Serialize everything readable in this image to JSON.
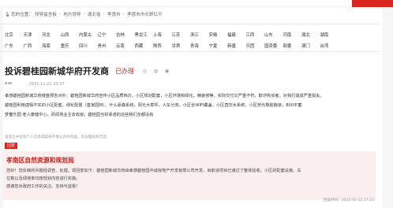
{
  "breadcrumb": {
    "prefix": "您的位置：",
    "items": [
      "领导留言板",
      "地方领导",
      "湖北省",
      "孝感市",
      "孝感市市长舒红平"
    ]
  },
  "regions": {
    "row1": [
      "北京",
      "天津",
      "河北",
      "山西",
      "内蒙古",
      "辽宁",
      "吉林",
      "黑龙江",
      "上海",
      "江苏",
      "浙江",
      "安徽",
      "福建",
      "江西",
      "山东",
      "河南",
      "湖北",
      "湖南"
    ],
    "row2": [
      "广东",
      "广西",
      "海南",
      "重庆",
      "四川",
      "贵州",
      "云南",
      "西藏",
      "陕西",
      "甘肃",
      "青海",
      "宁夏",
      "新疆",
      "兵团",
      "国资委",
      "部委",
      "澳门",
      "台湾"
    ]
  },
  "post": {
    "title": "投诉碧桂园新城华府开发商",
    "status": "已办理",
    "share_icons": [
      "weibo-icon",
      "wechat-icon",
      "qq-icon"
    ],
    "author": "",
    "date": "2021-11-22 20:37",
    "lines": [
      "孝感碧桂园新城华府楼盘预告对外：碧桂园新城华府宣传小区品质档次，小区规划配套，小区环境和绿化，精装修等，实际交付又严重不符，欺诈购买者，对我们造成严重损失。",
      "碧桂园利用虚假不实的小区配套，绿化配置（皇家园林）、什么豪森系统，阳光大草坪，人车分流，小区全WIFI覆盖，小区直饮水系统，小区荧光橡胶跑道，800平童",
      "梦童乐园 老人康健中心，而现场业主去收房，碧桂园当初承诺的这些我们全都没有"
    ],
    "disclaimer": "该留言中含有个人信息或其他不便公开的内容，仅办理机构可见。"
  },
  "reply": {
    "badge": "回复",
    "org": "孝南区自然资源和规划局",
    "lines": [
      "您好！您反映的问题经调查、处理，现回复如下：碧桂园新城华府由孝感碧桂园中诚房地产开发有限公司开发，目前该项目已通过了整体验收，小区的配套设施、车",
      "位数以及绿地率均按规划内容进行实施。",
      "感谢您对政府工作的关注、支持与监督！"
    ],
    "time": "回复时间：2022-01-12 17:23"
  }
}
